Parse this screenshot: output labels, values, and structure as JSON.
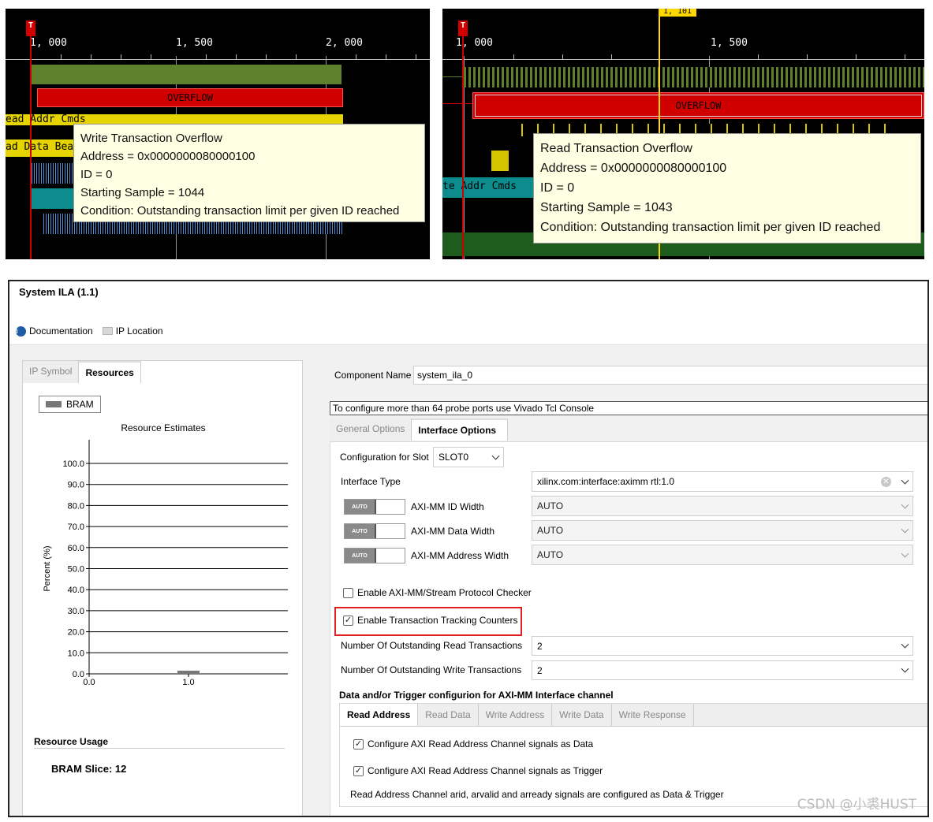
{
  "wave_left": {
    "tick_labels": [
      "1, 000",
      "1, 500",
      "2, 000"
    ],
    "marker": "T",
    "bar_labels": [
      "ead Addr Cmds",
      "ad Data Bea"
    ],
    "overflow_label": "OVERFLOW",
    "tooltip": {
      "title": "Write Transaction Overflow",
      "address": "Address = 0x0000000080000100",
      "id": "ID = 0",
      "sample": "Starting Sample = 1044",
      "condition": "Condition: Outstanding transaction limit per given ID reached"
    }
  },
  "wave_right": {
    "tick_labels": [
      "1, 000",
      "1, 500"
    ],
    "cursor_label": "1, 101",
    "marker": "T",
    "bar_labels": [
      "te Addr Cmds"
    ],
    "overflow_label": "OVERFLOW",
    "tooltip": {
      "title": "Read Transaction Overflow",
      "address": "Address = 0x0000000080000100",
      "id": "ID = 0",
      "sample": "Starting Sample = 1043",
      "condition": "Condition: Outstanding transaction limit per given ID reached"
    }
  },
  "dialog": {
    "title": "System ILA (1.1)",
    "links": {
      "documentation": "Documentation",
      "ip_location": "IP Location"
    },
    "left_tabs": [
      "IP Symbol",
      "Resources"
    ],
    "legend": "BRAM",
    "chart_title": "Resource Estimates",
    "resource_usage_title": "Resource Usage",
    "resource_usage_value": "BRAM Slice: 12",
    "component_name_label": "Component Name",
    "component_name_value": "system_ila_0",
    "notice": "To configure more than 64 probe ports use Vivado Tcl Console",
    "option_tabs": [
      "General Options",
      "Interface Options"
    ],
    "config_slot_label": "Configuration for Slot",
    "config_slot_value": "SLOT0",
    "interface_type_label": "Interface Type",
    "interface_type_value": "xilinx.com:interface:aximm rtl:1.0",
    "toggle_text": "AUTO",
    "id_width_label": "AXI-MM ID Width",
    "id_width_value": "AUTO",
    "data_width_label": "AXI-MM Data Width",
    "data_width_value": "AUTO",
    "addr_width_label": "AXI-MM Address Width",
    "addr_width_value": "AUTO",
    "protocol_checker_label": "Enable AXI-MM/Stream Protocol Checker",
    "tracking_counters_label": "Enable Transaction Tracking Counters",
    "outstanding_read_label": "Number Of Outstanding Read Transactions",
    "outstanding_read_value": "2",
    "outstanding_write_label": "Number Of Outstanding Write Transactions",
    "outstanding_write_value": "2",
    "channel_section_title": "Data and/or Trigger configurion for AXI-MM Interface channel",
    "channel_tabs": [
      "Read Address",
      "Read Data",
      "Write Address",
      "Write Data",
      "Write Response"
    ],
    "cfg_as_data_label": "Configure AXI Read Address Channel signals as Data",
    "cfg_as_trigger_label": "Configure AXI Read Address Channel signals as Trigger",
    "channel_note": "Read Address Channel arid, arvalid and arready signals are configured as Data & Trigger"
  },
  "chart_data": {
    "type": "bar",
    "title": "Resource Estimates",
    "ylabel": "Percent (%)",
    "y_ticks": [
      "100.0",
      "90.0",
      "80.0",
      "70.0",
      "60.0",
      "50.0",
      "40.0",
      "30.0",
      "20.0",
      "10.0",
      "0.0"
    ],
    "x_ticks": [
      "0.0",
      "1.0"
    ],
    "ylim": [
      0,
      100
    ],
    "xlim": [
      0,
      2
    ],
    "series": [
      {
        "name": "BRAM",
        "values": [
          1.5
        ]
      }
    ],
    "x": [
      1.0
    ],
    "grid": true,
    "legend_position": "top-left",
    "colors": {
      "bar": "#777777"
    }
  },
  "watermark": "CSDN @小裘HUST"
}
